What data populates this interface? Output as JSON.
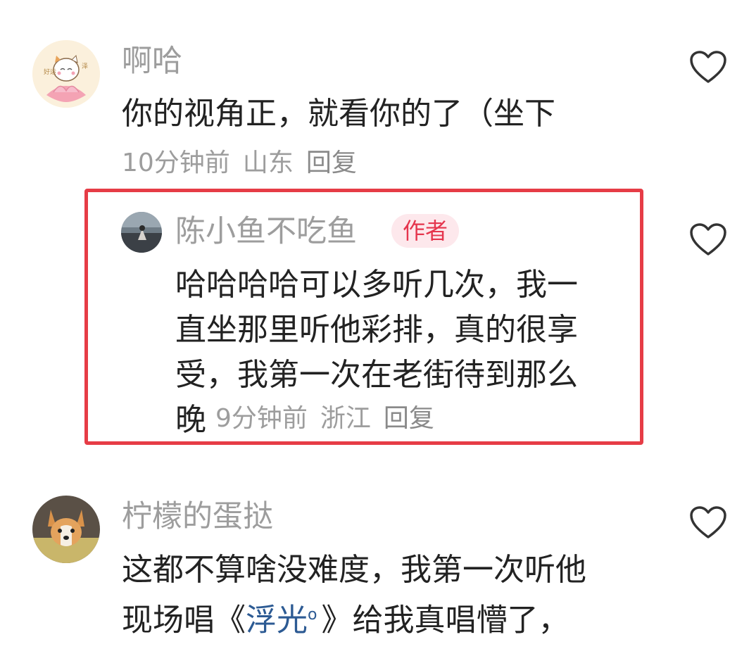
{
  "comments": [
    {
      "username": "啊哈",
      "text": "你的视角正，就看你的了（坐下",
      "time": "10分钟前",
      "location": "山东",
      "reply_label": "回复"
    },
    {
      "username": "陈小鱼不吃鱼",
      "badge": "作者",
      "lines": [
        "哈哈哈哈可以多听几次，我一",
        "直坐那里听他彩排，真的很享",
        "受，我第一次在老街待到那么",
        "晚"
      ],
      "time": "9分钟前",
      "location": "浙江",
      "reply_label": "回复"
    },
    {
      "username": "柠檬的蛋挞",
      "line1": "这都不算啥没难度，我第一次听他",
      "line2_prefix": "现场唱《",
      "topic": "浮光",
      "line2_suffix": "》给我真唱懵了，"
    }
  ],
  "colors": {
    "highlight_border": "#e63c46",
    "badge_bg": "#fde8ec",
    "badge_text": "#e5354d",
    "link": "#2c5a93"
  }
}
